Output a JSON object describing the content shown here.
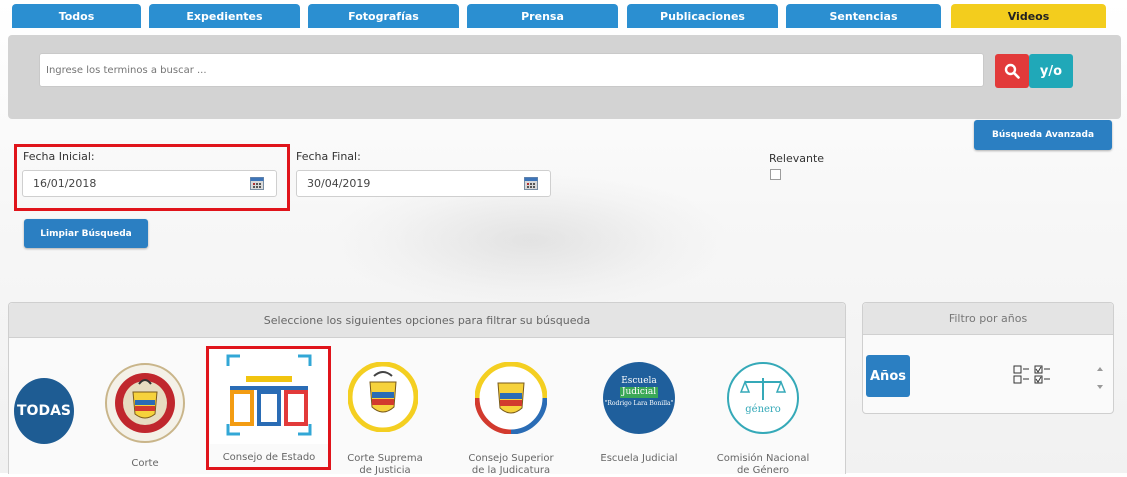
{
  "tabs": [
    "Todos",
    "Expedientes",
    "Fotografías",
    "Prensa",
    "Publicaciones",
    "Sentencias",
    "Videos"
  ],
  "active_tab": "Videos",
  "search": {
    "placeholder": "Ingrese los terminos a buscar ...",
    "yo_label": "y/o"
  },
  "advanced_search_label": "Búsqueda Avanzada",
  "dates": {
    "start_label": "Fecha Inicial:",
    "start_value": "16/01/2018",
    "end_label": "Fecha Final:",
    "end_value": "30/04/2019"
  },
  "relevant_label": "Relevante",
  "clear_search_label": "Limpiar Búsqueda",
  "filter": {
    "header": "Seleccione los siguientes opciones para filtrar su búsqueda",
    "all_label": "TODAS",
    "options": [
      {
        "name": "Corte",
        "icon": "colombia-court-seal-icon"
      },
      {
        "name": "Consejo de Estado",
        "icon": "council-of-state-building-icon"
      },
      {
        "name": "Corte Suprema de Justicia",
        "icon": "colombia-coat-of-arms-icon"
      },
      {
        "name": "Consejo Superior de la Judicatura",
        "icon": "judicature-coat-of-arms-icon"
      },
      {
        "name": "Escuela Judicial",
        "icon": "judicial-school-icon"
      },
      {
        "name": "Comisión Nacional de Género",
        "icon": "gender-commission-scales-icon"
      }
    ],
    "school_text": [
      "Escuela",
      "Judicial",
      "\"Rodrigo Lara Bonilla\""
    ],
    "gender_text": "género"
  },
  "years": {
    "header": "Filtro por años",
    "button": "Años"
  },
  "colors": {
    "tab_blue": "#2b8fd1",
    "tab_active": "#f3cd1d",
    "search_red": "#e23a3a",
    "teal": "#20a8b8",
    "highlight_red": "#e0141b"
  }
}
